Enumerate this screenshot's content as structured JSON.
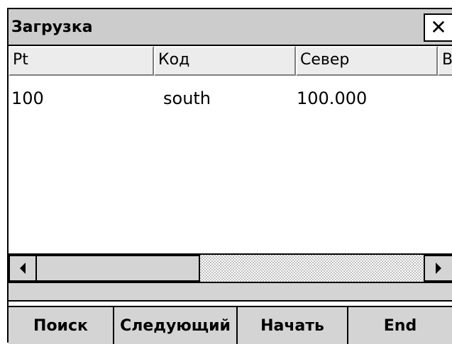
{
  "window": {
    "title": "Загрузка",
    "close_label": "✕"
  },
  "table": {
    "columns": [
      "Pt",
      "Код",
      "Север",
      "В"
    ],
    "rows": [
      {
        "pt": "100",
        "code": "south",
        "north": "100.000"
      }
    ]
  },
  "status": {
    "text": ""
  },
  "buttons": {
    "search": "Поиск",
    "next": "Следующий",
    "start": "Начать",
    "end": "End"
  },
  "colors": {
    "titlebar": "#cccccc",
    "header": "#ececec",
    "chrome": "#d4d4d4"
  }
}
